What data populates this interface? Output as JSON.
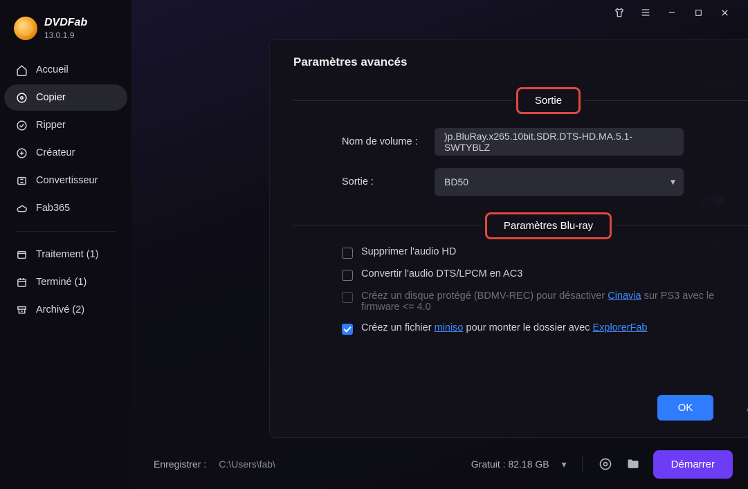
{
  "brand": {
    "name": "DVDFab",
    "version": "13.0.1.9"
  },
  "sidebar": {
    "items": [
      {
        "label": "Accueil"
      },
      {
        "label": "Copier"
      },
      {
        "label": "Ripper"
      },
      {
        "label": "Créateur"
      },
      {
        "label": "Convertisseur"
      },
      {
        "label": "Fab365"
      }
    ],
    "status": [
      {
        "label": "Traitement (1)"
      },
      {
        "label": "Terminé (1)"
      },
      {
        "label": "Archivé (2)"
      }
    ]
  },
  "background": {
    "right_text": "ec des"
  },
  "bottombar": {
    "save_label": "Enregistrer :",
    "path": "C:\\Users\\fab\\",
    "free_label": "Gratuit : 82.18 GB",
    "start_label": "Démarrer"
  },
  "modal": {
    "title": "Paramètres avancés",
    "section1": "Sortie",
    "volume_label": "Nom de volume :",
    "volume_value": ")p.BluRay.x265.10bit.SDR.DTS-HD.MA.5.1-SWTYBLZ",
    "output_label": "Sortie :",
    "output_value": "BD50",
    "section2": "Paramètres Blu-ray",
    "chk1": "Supprimer l'audio HD",
    "chk2": "Convertir l'audio DTS/LPCM en AC3",
    "chk3_a": "Créez un disque protégé (BDMV-REC) pour désactiver ",
    "chk3_link": "Cinavia",
    "chk3_b": " sur PS3 avec le firmware <= 4.0",
    "chk4_a": "Créez un fichier ",
    "chk4_link1": "miniso",
    "chk4_b": " pour monter le dossier avec ",
    "chk4_link2": "ExplorerFab",
    "ok": "OK",
    "cancel": "Annuler"
  }
}
